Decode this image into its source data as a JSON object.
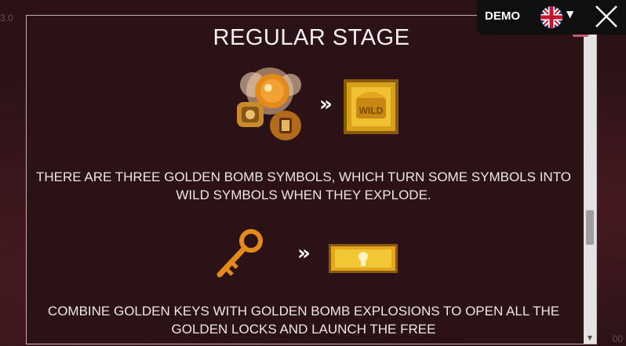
{
  "background": {
    "left_label": "3.0",
    "right_label": "00"
  },
  "rules": {
    "title": "REGULAR STAGE",
    "section1": {
      "description": "THERE ARE THREE GOLDEN BOMB SYMBOLS, WHICH TURN SOME SYMBOLS INTO WILD SYMBOLS WHEN THEY EXPLODE.",
      "arrow": "»",
      "result_symbol_text": "WILD",
      "icons": [
        "golden-bombs-icon",
        "wild-chest-icon"
      ]
    },
    "section2": {
      "description": "COMBINE GOLDEN KEYS WITH GOLDEN BOMB EXPLOSIONS TO OPEN ALL THE GOLDEN LOCKS AND LAUNCH THE FREE",
      "arrow": "»",
      "icons": [
        "golden-key-icon",
        "golden-lock-icon"
      ]
    },
    "close_small": "x"
  },
  "topbar": {
    "demo_label": "DEMO",
    "language_icon": "uk-flag-icon",
    "language_caret": "▼",
    "close_icon": "close-icon"
  },
  "scrollbar": {
    "up": "▲",
    "down": "▼"
  },
  "colors": {
    "panel_bg": "#2b1216",
    "gold": "#e5a51c",
    "topbar_bg": "#0f0f10",
    "accent_pink": "#c45b79"
  }
}
